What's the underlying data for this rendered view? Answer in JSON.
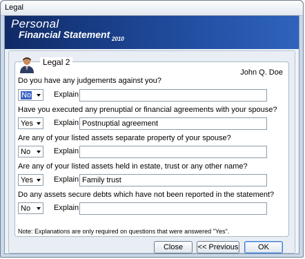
{
  "window": {
    "title": "Legal"
  },
  "banner": {
    "line1": "Personal",
    "line2": "Financial Statement",
    "year": "2010"
  },
  "section": {
    "title": "Legal 2",
    "client_name": "John Q. Doe"
  },
  "explain_label": "Explain:",
  "questions": [
    {
      "text": "Do you have any judgements against you?",
      "answer": "No",
      "explain": ""
    },
    {
      "text": "Have you executed any prenuptial or financial agreements with your spouse?",
      "answer": "Yes",
      "explain": "Postnuptial agreement"
    },
    {
      "text": "Are any of your listed assets separate property of your spouse?",
      "answer": "No",
      "explain": ""
    },
    {
      "text": "Are any of your listed assets held in estate, trust or any other name?",
      "answer": "Yes",
      "explain": "Family trust"
    },
    {
      "text": "Do any assets secure debts which have not been reported in the statement?",
      "answer": "No",
      "explain": ""
    }
  ],
  "note": "Note:  Explanations are only required on questions that were answered \"Yes\".",
  "buttons": {
    "close": "Close",
    "previous": "<< Previous",
    "ok": "OK"
  }
}
